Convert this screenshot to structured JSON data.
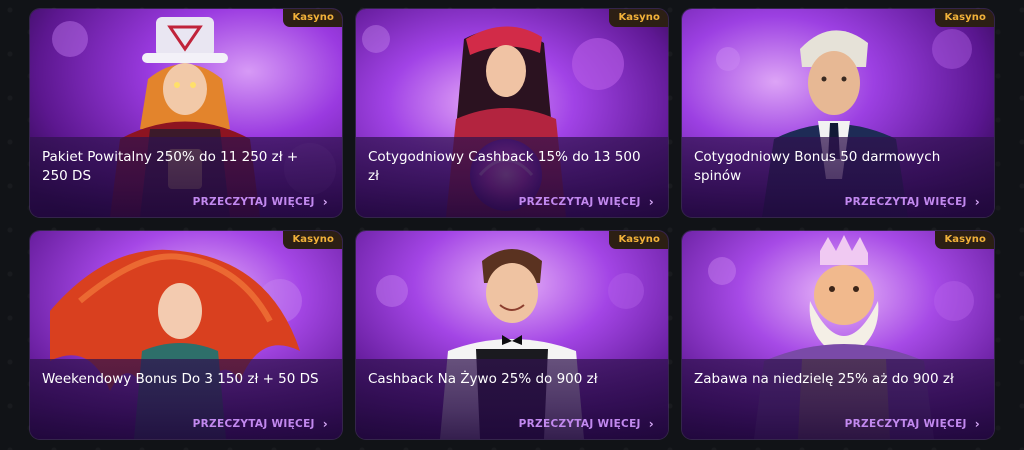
{
  "cards": [
    {
      "badge": "Kasyno",
      "title": "Pakiet Powitalny 250% do 11 250 zł + 250 DS",
      "cta": "PRZECZYTAJ WIĘCEJ",
      "character": "wizard-magician"
    },
    {
      "badge": "Kasyno",
      "title": "Cotygodniowy Cashback 15% do 13 500 zł",
      "cta": "PRZECZYTAJ WIĘCEJ",
      "character": "fortune-teller"
    },
    {
      "badge": "Kasyno",
      "title": "Cotygodniowy Bonus 50 darmowych spinów",
      "cta": "PRZECZYTAJ WIĘCEJ",
      "character": "young-gentleman"
    },
    {
      "badge": "Kasyno",
      "title": "Weekendowy Bonus Do 3 150 zł + 50 DS",
      "cta": "PRZECZYTAJ WIĘCEJ",
      "character": "red-haired-siren"
    },
    {
      "badge": "Kasyno",
      "title": "Cashback Na Żywo 25% do 900 zł",
      "cta": "PRZECZYTAJ WIĘCEJ",
      "character": "croupier"
    },
    {
      "badge": "Kasyno",
      "title": "Zabawa na niedzielę 25% aż do 900 zł",
      "cta": "PRZECZYTAJ WIĘCEJ",
      "character": "bearded-king"
    }
  ],
  "colors": {
    "background": "#111317",
    "badge_bg": "#2c1f14",
    "badge_text": "#f2b23a",
    "cta_text": "#c289ef",
    "card_purple": "#7b2fc6"
  },
  "icons": {
    "cta": "chevron-right-icon"
  }
}
